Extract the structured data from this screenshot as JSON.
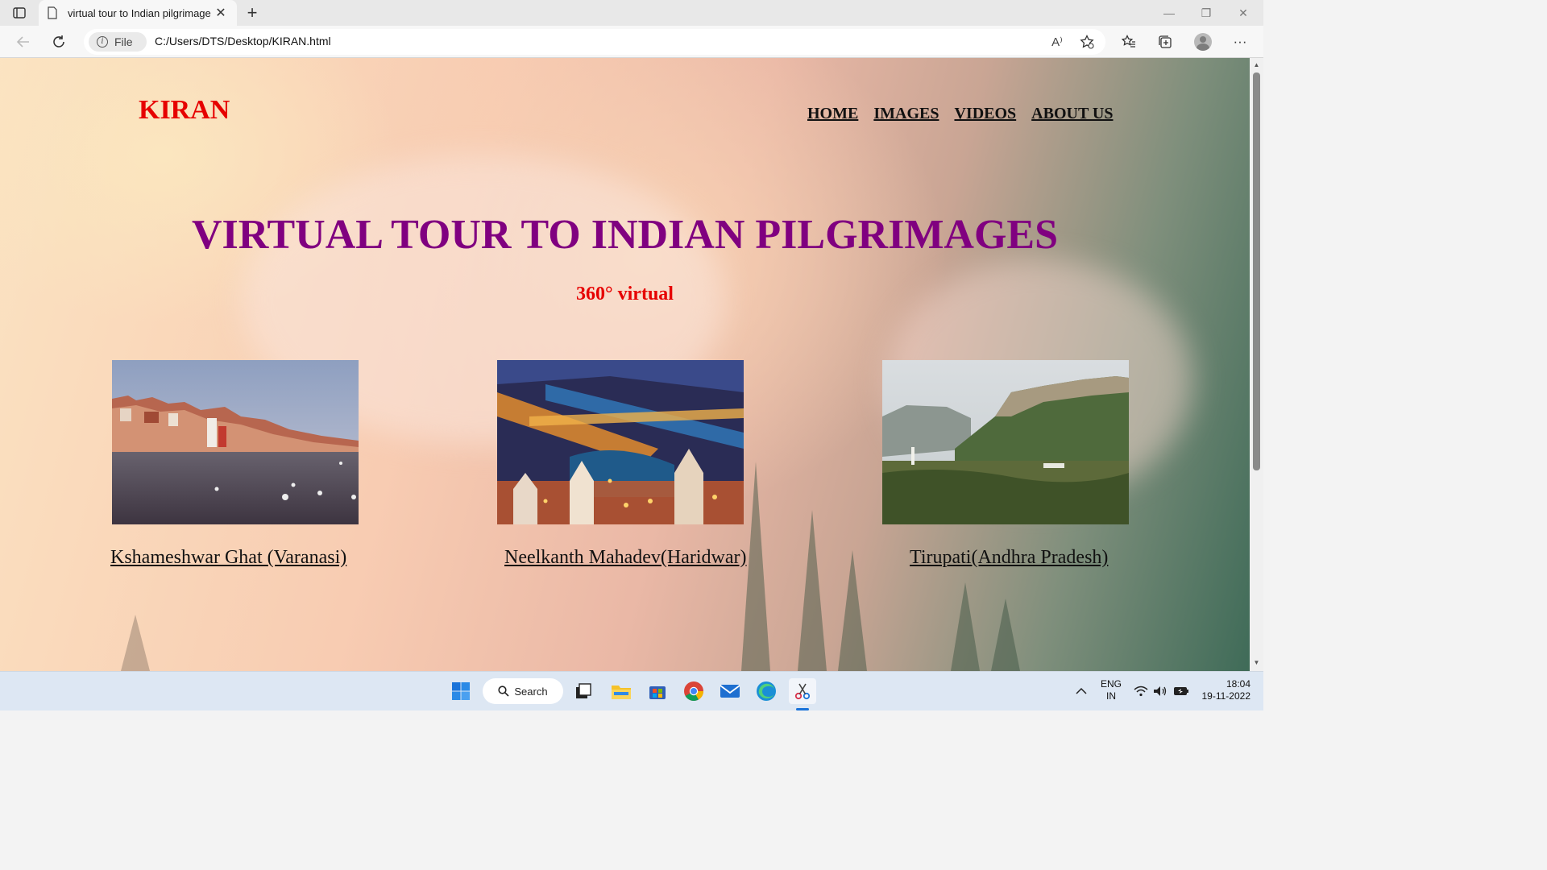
{
  "browser": {
    "tab_title": "virtual tour to Indian pilgrimage",
    "tab_close": "✕",
    "new_tab": "+",
    "file_chip": "File",
    "url": "C:/Users/DTS/Desktop/KIRAN.html",
    "read_aloud": "A⁾",
    "window_controls": {
      "minimize": "—",
      "restore": "❐",
      "close": "✕"
    },
    "more": "···"
  },
  "page": {
    "brand": "KIRAN",
    "nav": [
      "HOME",
      "IMAGES",
      "VIDEOS",
      "ABOUT US"
    ],
    "title": "VIRTUAL TOUR TO INDIAN PILGRIMAGES",
    "subtitle": "360° virtual",
    "cards": [
      {
        "caption": "Kshameshwar Ghat (Varanasi)",
        "image": "varanasi-ghat-photo"
      },
      {
        "caption": "Neelkanth Mahadev(Haridwar)",
        "image": "haridwar-night-photo"
      },
      {
        "caption": "Tirupati(Andhra Pradesh)",
        "image": "tirupati-hills-photo"
      }
    ]
  },
  "taskbar": {
    "search_label": "Search",
    "language": "ENG",
    "region": "IN",
    "time": "18:04",
    "date": "19-11-2022"
  },
  "colors": {
    "brand": "#e60000",
    "title": "#800080",
    "subtitle": "#e60000"
  }
}
